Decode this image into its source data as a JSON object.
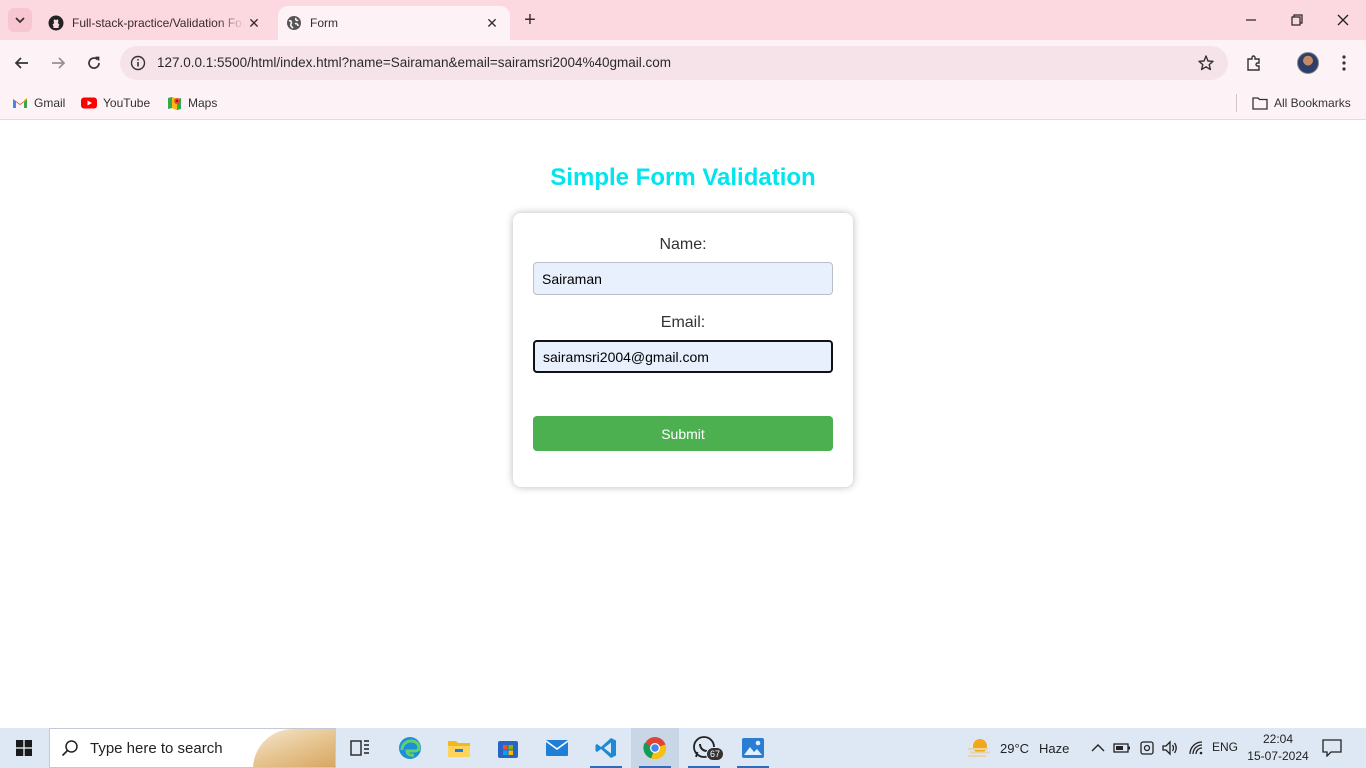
{
  "browser": {
    "tabs": [
      {
        "label": "Full-stack-practice/Validation Form",
        "icon": "github-icon",
        "active": false
      },
      {
        "label": "Form",
        "icon": "globe-icon",
        "active": true
      }
    ],
    "url": "127.0.0.1:5500/html/index.html?name=Sairaman&email=sairamsri2004%40gmail.com",
    "bookmarks": [
      {
        "label": "Gmail",
        "icon": "gmail-icon"
      },
      {
        "label": "YouTube",
        "icon": "youtube-icon"
      },
      {
        "label": "Maps",
        "icon": "maps-icon"
      }
    ],
    "all_bookmarks_label": "All Bookmarks"
  },
  "page": {
    "title": "Simple Form Validation",
    "title_color": "#00e5ee",
    "form": {
      "name_label": "Name:",
      "name_value": "Sairaman",
      "email_label": "Email:",
      "email_value": "sairamsri2004@gmail.com",
      "submit_label": "Submit",
      "submit_color": "#4caf50"
    }
  },
  "taskbar": {
    "search_placeholder": "Type here to search",
    "whatsapp_badge": "67",
    "weather": {
      "temp": "29°C",
      "condition": "Haze"
    },
    "language": "ENG",
    "time": "22:04",
    "date": "15-07-2024"
  }
}
